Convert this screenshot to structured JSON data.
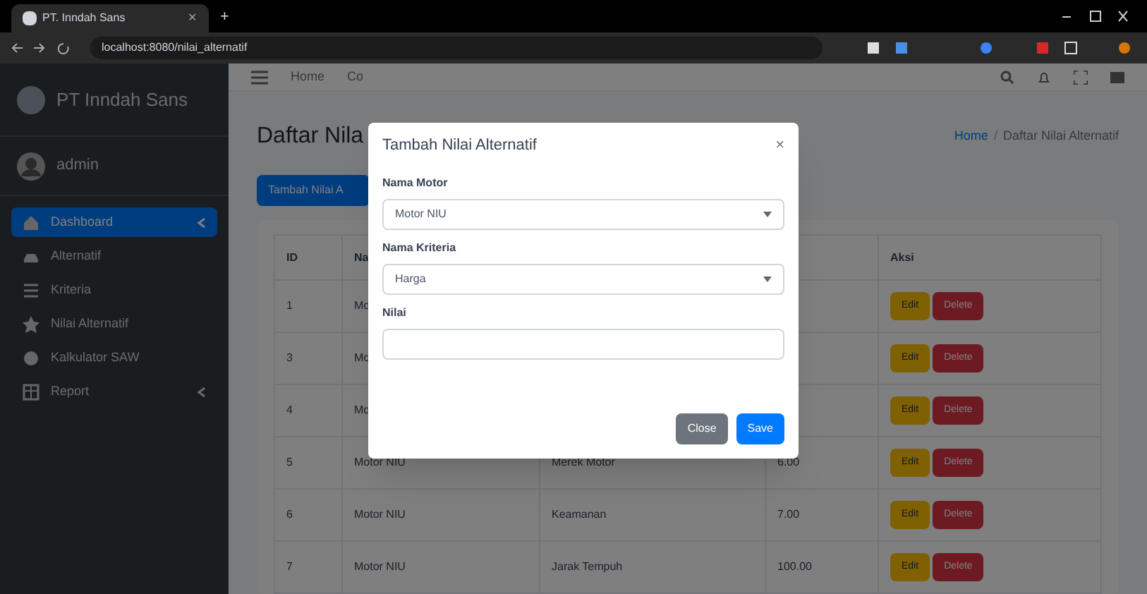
{
  "browser": {
    "tab_title": "PT. Inndah Sans",
    "tab_close": "✕",
    "new_tab": "+",
    "url": "localhost:8080/nilai_alternatif"
  },
  "sidebar": {
    "brand": "PT Inndah Sans",
    "user": "admin",
    "items": [
      {
        "label": "Dashboard",
        "selected": true,
        "has_submenu": true
      },
      {
        "label": "Alternatif",
        "selected": false,
        "has_submenu": false
      },
      {
        "label": "Kriteria",
        "selected": false,
        "has_submenu": false
      },
      {
        "label": "Nilai Alternatif",
        "selected": false,
        "has_submenu": false
      },
      {
        "label": "Kalkulator SAW",
        "selected": false,
        "has_submenu": false
      },
      {
        "label": "Report",
        "selected": false,
        "has_submenu": true
      }
    ]
  },
  "navbar": {
    "links": [
      "Home",
      "Co"
    ]
  },
  "page": {
    "title": "Daftar Nila",
    "breadcrumb": [
      "Home",
      "/",
      "Daftar Nilai Alternatif"
    ],
    "add_button": "Tambah Nilai A"
  },
  "table": {
    "columns": [
      "ID",
      "Na",
      null,
      null,
      "Aksi"
    ],
    "rows": [
      {
        "cells": [
          "1",
          "Mo",
          null,
          null
        ],
        "actions": [
          "Edit",
          "Delete"
        ]
      },
      {
        "cells": [
          "3",
          "Mo",
          null,
          null
        ],
        "actions": [
          "Edit",
          "Delete"
        ]
      },
      {
        "cells": [
          "4",
          "Mo",
          null,
          null
        ],
        "actions": [
          "Edit",
          "Delete"
        ]
      },
      {
        "cells": [
          "5",
          "Motor NIU",
          "Merek Motor",
          "6.00"
        ],
        "actions": [
          "Edit",
          "Delete"
        ]
      },
      {
        "cells": [
          "6",
          "Motor NIU",
          "Keamanan",
          "7.00"
        ],
        "actions": [
          "Edit",
          "Delete"
        ]
      },
      {
        "cells": [
          "7",
          "Motor NIU",
          "Jarak Tempuh",
          "100.00"
        ],
        "actions": [
          "Edit",
          "Delete"
        ]
      }
    ]
  },
  "modal": {
    "title": "Tambah Nilai Alternatif",
    "close": "×",
    "fields": [
      {
        "label": "Nama Motor",
        "kind": "select",
        "value": "Motor NIU"
      },
      {
        "label": "Nama Kriteria",
        "kind": "select",
        "value": "Harga"
      },
      {
        "label": "Nilai",
        "kind": "input"
      }
    ],
    "buttons": [
      {
        "label": "Close",
        "kind": "secondary"
      },
      {
        "label": "Save",
        "kind": "primary"
      }
    ]
  }
}
